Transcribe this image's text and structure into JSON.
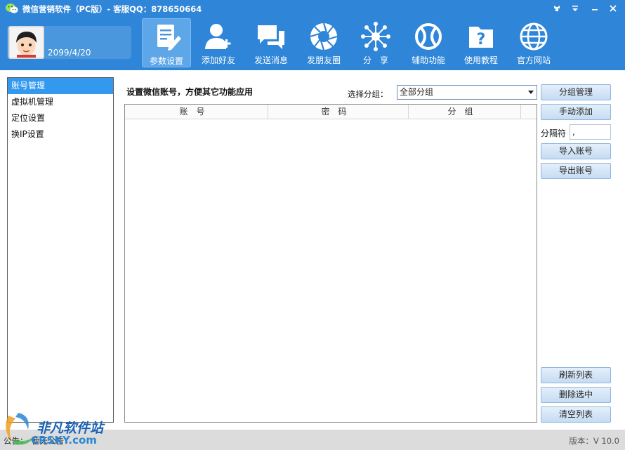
{
  "window": {
    "title": "微信营销软件（PC版）- 客服QQ：878650664",
    "controls": [
      "skin-icon",
      "menu-icon",
      "minimize-icon",
      "close-icon"
    ]
  },
  "profile": {
    "date": "2099/4/20"
  },
  "toolbar": {
    "items": [
      {
        "label": "参数设置",
        "icon": "document-edit-icon",
        "active": true
      },
      {
        "label": "添加好友",
        "icon": "add-user-icon"
      },
      {
        "label": "发送消息",
        "icon": "chat-bubbles-icon"
      },
      {
        "label": "发朋友圈",
        "icon": "camera-aperture-icon"
      },
      {
        "label": "分　享",
        "icon": "share-network-icon"
      },
      {
        "label": "辅助功能",
        "icon": "tools-icon"
      },
      {
        "label": "使用教程",
        "icon": "help-folder-icon"
      },
      {
        "label": "官方网站",
        "icon": "globe-icon"
      }
    ]
  },
  "sidebar": {
    "items": [
      {
        "label": "账号管理",
        "selected": true
      },
      {
        "label": "虚拟机管理"
      },
      {
        "label": "定位设置"
      },
      {
        "label": "换IP设置"
      }
    ]
  },
  "main": {
    "title": "设置微信账号，方便其它功能应用",
    "group_label": "选择分组：",
    "group_selected": "全部分组",
    "columns": [
      "账号",
      "密码",
      "分组"
    ],
    "separator_label": "分隔符",
    "separator_value": ","
  },
  "buttons": {
    "group_manage": "分组管理",
    "manual_add": "手动添加",
    "import": "导入账号",
    "export": "导出账号",
    "refresh": "刷新列表",
    "delete_selected": "删除选中",
    "clear": "清空列表"
  },
  "status": {
    "notice_label": "公告：",
    "notice_text": "暂无公告",
    "version": "版本：V 10.0"
  },
  "watermark": {
    "line1": "非凡软件站",
    "line2": "CRSKY.com"
  },
  "colors": {
    "header_blue": "#2f86d8",
    "selected_blue": "#3399ee",
    "button_gradient_top": "#e4effb",
    "button_gradient_bottom": "#c6dcf3"
  }
}
